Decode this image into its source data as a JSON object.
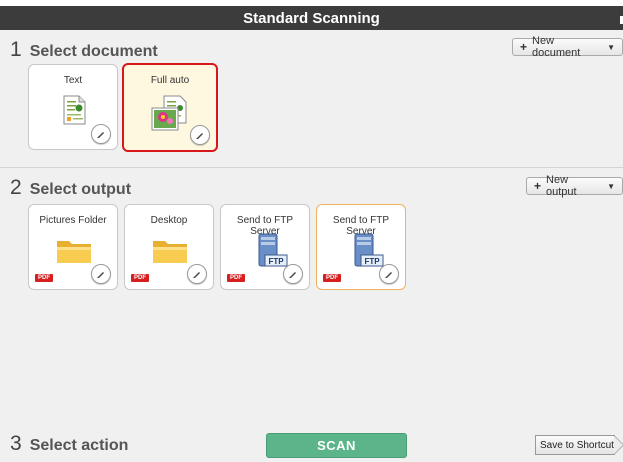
{
  "window": {
    "title": "Standard Scanning"
  },
  "section1": {
    "number": "1",
    "label": "Select document",
    "new_button_label": "New document",
    "cards": [
      {
        "title": "Text",
        "icon": "text-document-icon",
        "selected": false
      },
      {
        "title": "Full auto",
        "icon": "auto-photo-document-icon",
        "selected": true
      }
    ]
  },
  "section2": {
    "number": "2",
    "label": "Select output",
    "new_button_label": "New output",
    "cards": [
      {
        "title": "Pictures Folder",
        "icon": "folder-icon",
        "badge": "PDF"
      },
      {
        "title": "Desktop",
        "icon": "folder-icon",
        "badge": "PDF"
      },
      {
        "title": "Send to FTP Server",
        "icon": "ftp-server-icon",
        "badge": "PDF",
        "server_label": "FTP"
      },
      {
        "title": "Send to FTP Server",
        "icon": "ftp-server-icon",
        "badge": "PDF",
        "server_label": "FTP"
      }
    ]
  },
  "section3": {
    "number": "3",
    "label": "Select action",
    "scan_label": "SCAN",
    "shortcut_label": "Save to Shortcut"
  },
  "colors": {
    "titlebar": "#3c3c3c",
    "selected_border": "#d81818",
    "selected_bg": "#fff8e1",
    "scan_button": "#5cb58a",
    "pdf_badge": "#d61f1f"
  }
}
